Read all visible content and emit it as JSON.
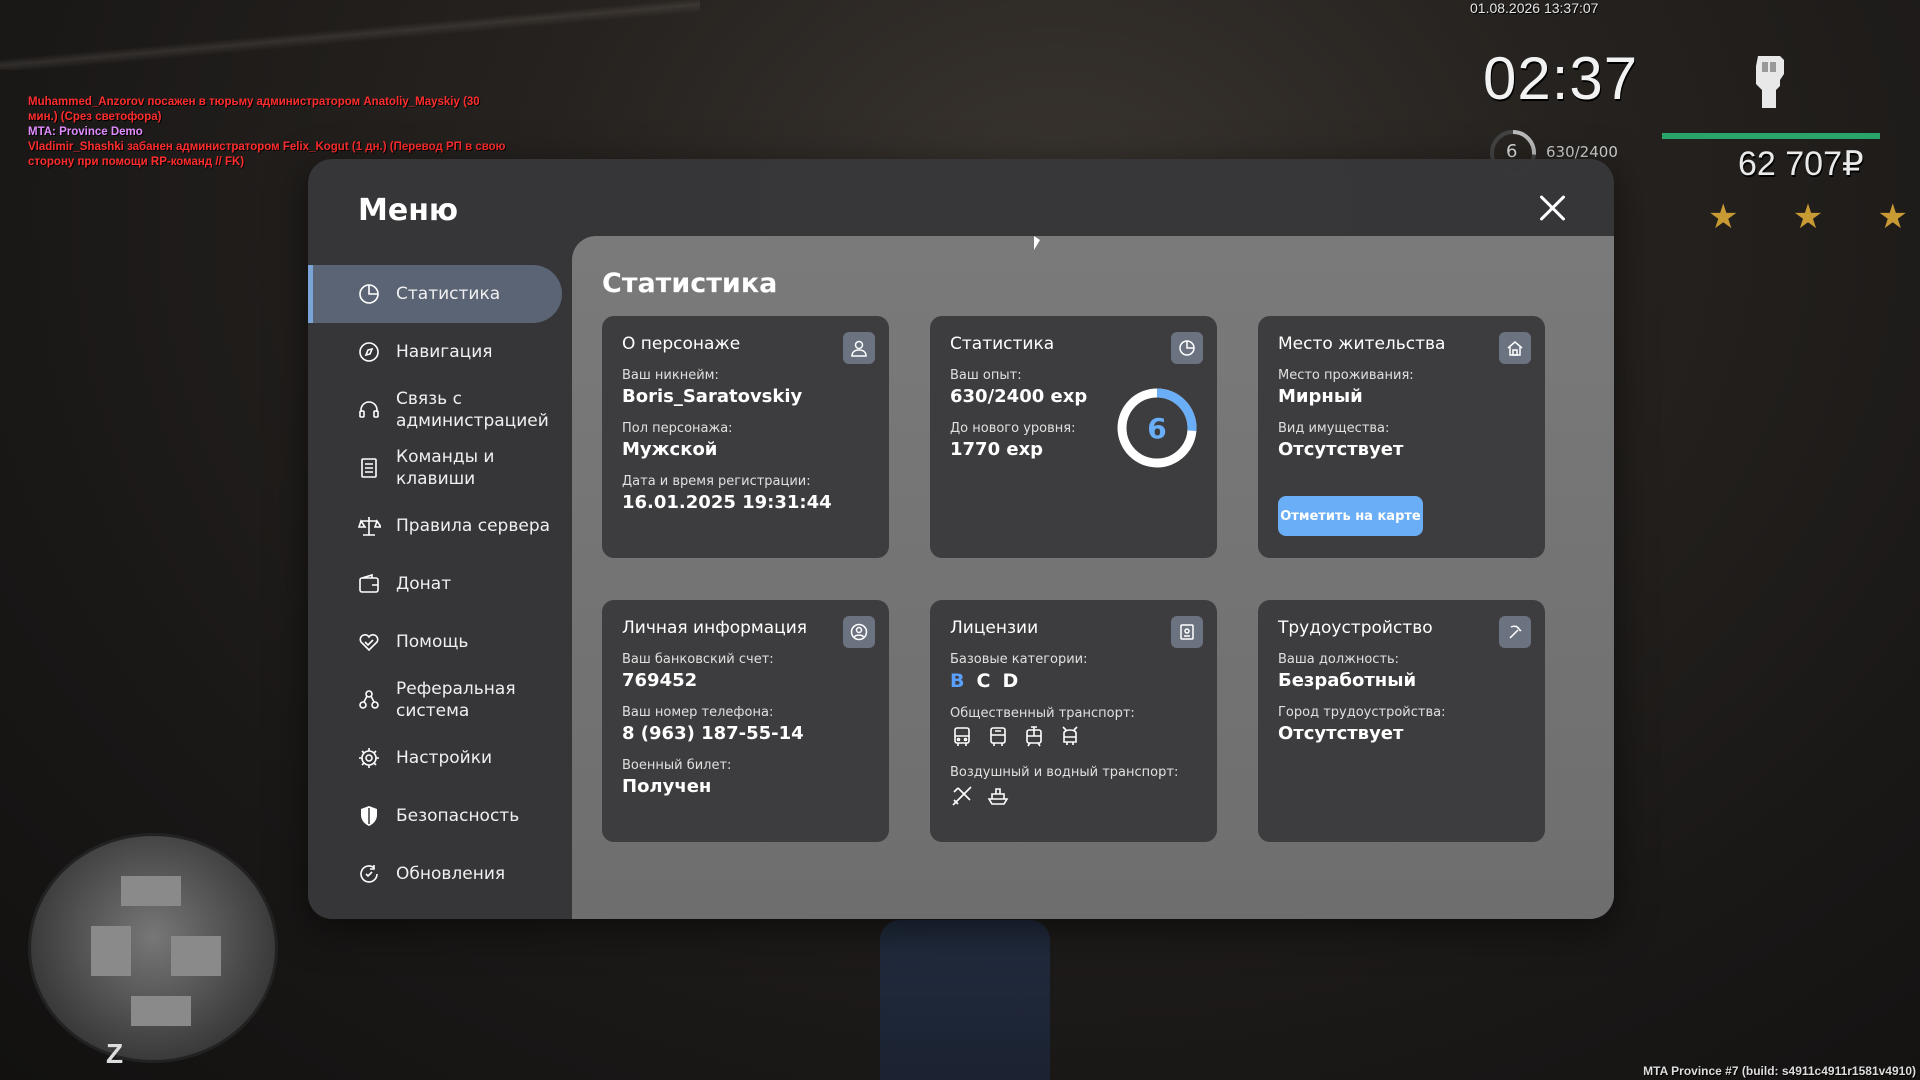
{
  "hud": {
    "datetime": "01.08.2026 13:37:07",
    "time": "02:37",
    "level": "6",
    "exp": "630/2400",
    "money": "62 707₽",
    "stars": [
      "★",
      "★",
      "★"
    ],
    "build": "MTA Province #7 (build: s4911c4911r1581v4910)",
    "radar_letter": "Z"
  },
  "chat": [
    {
      "text": "Muhammed_Anzorov посажен в тюрьму администратором Anatoliy_Mayskiy (30 мин.) (Срез светофора)",
      "color": "red"
    },
    {
      "text": "MTA: Province Demo",
      "color": "violet"
    },
    {
      "text": "Vladimir_Shashki забанен администратором Felix_Kogut (1 дн.) (Перевод РП в свою сторону при помощи RP-команд // FK)",
      "color": "red"
    }
  ],
  "menu": {
    "title": "Меню",
    "sidebar": [
      {
        "label": "Статистика",
        "icon": "stats-icon"
      },
      {
        "label": "Навигация",
        "icon": "compass-icon"
      },
      {
        "label": "Связь с администрацией",
        "icon": "headset-icon"
      },
      {
        "label": "Команды и клавиши",
        "icon": "list-icon"
      },
      {
        "label": "Правила сервера",
        "icon": "scales-icon"
      },
      {
        "label": "Донат",
        "icon": "wallet-icon"
      },
      {
        "label": "Помощь",
        "icon": "heart-hands-icon"
      },
      {
        "label": "Реферальная система",
        "icon": "referral-icon"
      },
      {
        "label": "Настройки",
        "icon": "gear-icon"
      },
      {
        "label": "Безопасность",
        "icon": "shield-icon"
      },
      {
        "label": "Обновления",
        "icon": "refresh-icon"
      }
    ],
    "content_title": "Статистика",
    "cards": {
      "character": {
        "title": "О персонаже",
        "nick_label": "Ваш никнейм:",
        "nick": "Boris_Saratovskiy",
        "gender_label": "Пол персонажа:",
        "gender": "Мужской",
        "reg_label": "Дата и время регистрации:",
        "reg": "16.01.2025 19:31:44"
      },
      "stats": {
        "title": "Статистика",
        "exp_label": "Ваш опыт:",
        "exp": "630/2400 exp",
        "next_label": "До нового уровня:",
        "next": "1770 exp",
        "level": "6",
        "progress": 0.2625
      },
      "residence": {
        "title": "Место жительства",
        "place_label": "Место проживания:",
        "place": "Мирный",
        "property_label": "Вид имущества:",
        "property": "Отсутствует",
        "button": "Отметить на карте"
      },
      "personal": {
        "title": "Личная информация",
        "bank_label": "Ваш банковский счет:",
        "bank": "769452",
        "phone_label": "Ваш номер телефона:",
        "phone": "8 (963) 187-55-14",
        "military_label": "Военный билет:",
        "military": "Получен"
      },
      "licenses": {
        "title": "Лицензии",
        "base_label": "Базовые категории:",
        "categories": [
          "B",
          "C",
          "D"
        ],
        "public_label": "Общественный транспорт:",
        "public_icons": [
          "bus-icon",
          "bus-icon",
          "tram-icon",
          "trolleybus-icon"
        ],
        "air_label": "Воздушный и водный транспорт:",
        "air_icons": [
          "plane-icon",
          "boat-icon"
        ]
      },
      "employment": {
        "title": "Трудоустройство",
        "position_label": "Ваша должность:",
        "position": "Безработный",
        "city_label": "Город трудоустройства:",
        "city": "Отсутствует"
      }
    }
  },
  "colors": {
    "accent": "#6aaef7",
    "active_sidebar": "#5b6474",
    "chat_red": "#ff2d2d",
    "chat_violet": "#e08bff",
    "health": "#2aa46a",
    "star": "#c89a34"
  }
}
